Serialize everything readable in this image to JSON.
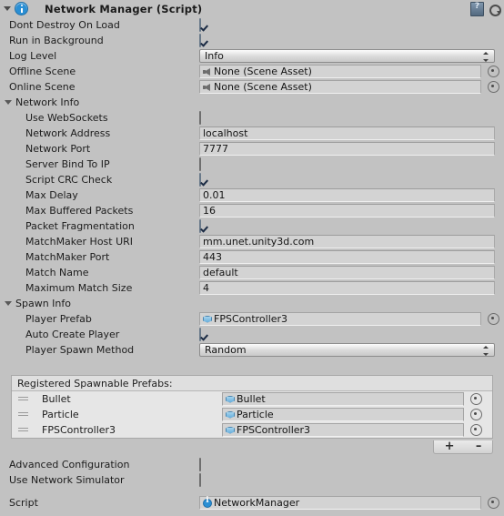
{
  "header": {
    "title": "Network Manager (Script)",
    "foldout_icon": "triangle-down-icon",
    "component_icon": "info-icon",
    "help_icon": "help-book-icon",
    "gear_icon": "settings-gear-icon"
  },
  "top_fields": [
    {
      "label": "Dont Destroy On Load",
      "type": "checkbox",
      "value": true
    },
    {
      "label": "Run in Background",
      "type": "checkbox",
      "value": true
    },
    {
      "label": "Log Level",
      "type": "dropdown",
      "value": "Info"
    },
    {
      "label": "Offline Scene",
      "type": "object",
      "value": "None (Scene Asset)",
      "icon": "scene-asset-icon"
    },
    {
      "label": "Online Scene",
      "type": "object",
      "value": "None (Scene Asset)",
      "icon": "scene-asset-icon"
    }
  ],
  "network_info": {
    "title": "Network Info",
    "fields": [
      {
        "label": "Use WebSockets",
        "type": "checkbox",
        "value": false
      },
      {
        "label": "Network Address",
        "type": "text",
        "value": "localhost"
      },
      {
        "label": "Network Port",
        "type": "text",
        "value": "7777"
      },
      {
        "label": "Server Bind To IP",
        "type": "checkbox",
        "value": false
      },
      {
        "label": "Script CRC Check",
        "type": "checkbox",
        "value": true
      },
      {
        "label": "Max Delay",
        "type": "text",
        "value": "0.01"
      },
      {
        "label": "Max Buffered Packets",
        "type": "text",
        "value": "16"
      },
      {
        "label": "Packet Fragmentation",
        "type": "checkbox",
        "value": true
      },
      {
        "label": "MatchMaker Host URI",
        "type": "text",
        "value": "mm.unet.unity3d.com"
      },
      {
        "label": "MatchMaker Port",
        "type": "text",
        "value": "443"
      },
      {
        "label": "Match Name",
        "type": "text",
        "value": "default"
      },
      {
        "label": "Maximum Match Size",
        "type": "text",
        "value": "4"
      }
    ]
  },
  "spawn_info": {
    "title": "Spawn Info",
    "fields": [
      {
        "label": "Player Prefab",
        "type": "object",
        "value": "FPSController3",
        "icon": "prefab-cube-icon"
      },
      {
        "label": "Auto Create Player",
        "type": "checkbox",
        "value": true
      },
      {
        "label": "Player Spawn Method",
        "type": "dropdown",
        "value": "Random"
      }
    ]
  },
  "spawnable_prefabs": {
    "header": "Registered Spawnable Prefabs:",
    "items": [
      {
        "name": "Bullet",
        "value": "Bullet",
        "icon": "prefab-cube-icon"
      },
      {
        "name": "Particle",
        "value": "Particle",
        "icon": "prefab-cube-icon"
      },
      {
        "name": "FPSController3",
        "value": "FPSController3",
        "icon": "prefab-cube-icon"
      }
    ],
    "add_label": "+",
    "remove_label": "–"
  },
  "bottom_fields": [
    {
      "label": "Advanced Configuration",
      "type": "checkbox",
      "value": false
    },
    {
      "label": "Use Network Simulator",
      "type": "checkbox",
      "value": false
    }
  ],
  "script_field": {
    "label": "Script",
    "value": "NetworkManager",
    "icon": "script-info-icon"
  },
  "colors": {
    "background": "#c2c2c2",
    "field_background": "#d3d3d3",
    "list_background": "#e6e6e6",
    "accent_blue": "#2a8fd4",
    "prefab_cube": "#69aedb"
  }
}
